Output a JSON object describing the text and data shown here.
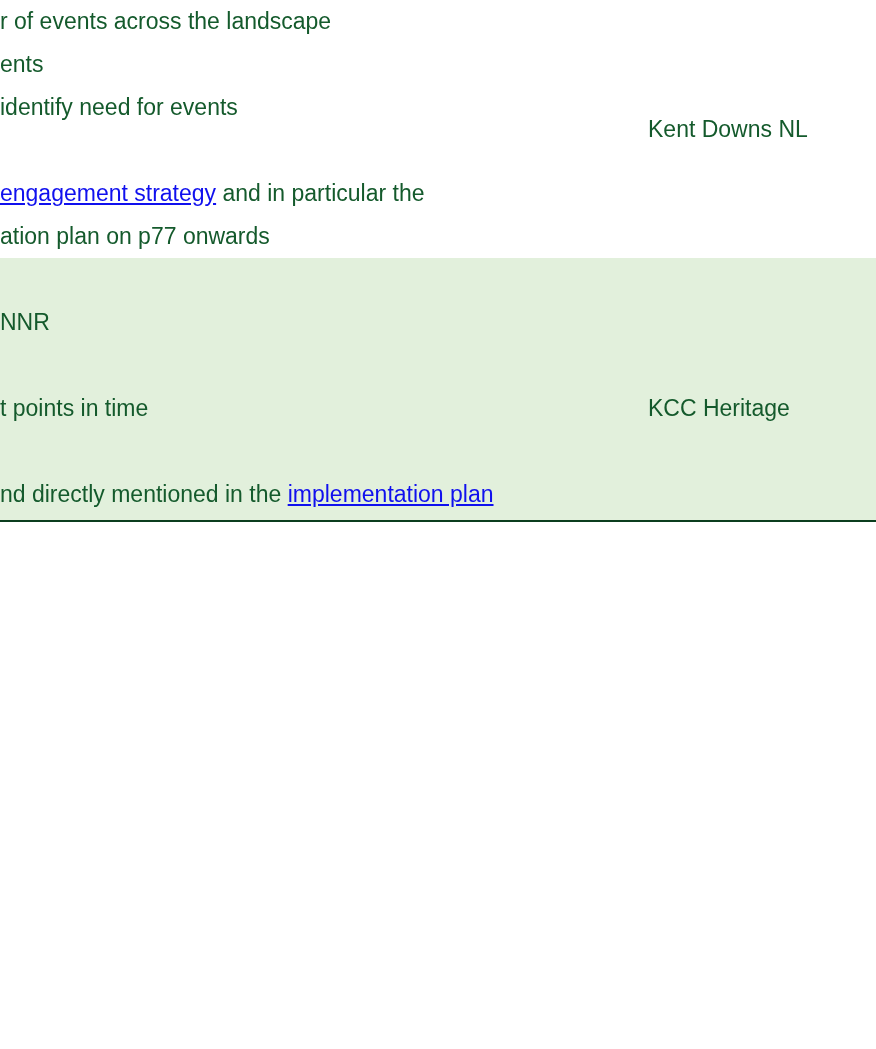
{
  "table": {
    "rows": [
      {
        "shaded": false,
        "paragraphs": [
          [
            [
              {
                "kind": "text",
                "text": "r of events across the landscape"
              }
            ],
            [
              {
                "kind": "text",
                "text": "ents"
              }
            ],
            [
              {
                "kind": "text",
                "text": "identify need for events"
              }
            ]
          ],
          [
            [
              {
                "kind": "link",
                "text": "engagement strategy"
              },
              {
                "kind": "text",
                "text": " and in particular the"
              }
            ],
            [
              {
                "kind": "text",
                "text": "ation plan on p77 onwards"
              }
            ]
          ]
        ],
        "owner": "Kent Downs NL"
      },
      {
        "shaded": true,
        "paragraphs": [
          [
            [
              {
                "kind": "text",
                "text": "NNR"
              }
            ]
          ],
          [
            [
              {
                "kind": "text",
                "text": "t points in time"
              }
            ]
          ],
          [
            [
              {
                "kind": "text",
                "text": "nd directly mentioned in the "
              },
              {
                "kind": "link",
                "text": "implementation plan"
              }
            ]
          ]
        ],
        "owner": "KCC Heritage"
      }
    ]
  }
}
